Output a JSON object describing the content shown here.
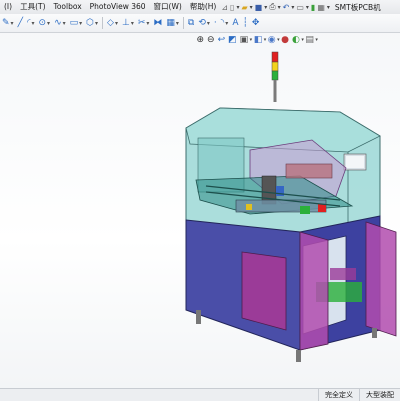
{
  "menubar": {
    "items": [
      {
        "label": "(I)",
        "name": "menu-insert"
      },
      {
        "label": "工具(T)",
        "name": "menu-tools"
      },
      {
        "label": "Toolbox",
        "name": "menu-toolbox"
      },
      {
        "label": "PhotoView 360",
        "name": "menu-photoview"
      },
      {
        "label": "窗口(W)",
        "name": "menu-window"
      },
      {
        "label": "帮助(H)",
        "name": "menu-help"
      }
    ],
    "document_title": "SMT板PCB机"
  },
  "statusbar": {
    "definition_status": "完全定义",
    "units": "大型装配"
  },
  "colors": {
    "enclosure_glass": "#8fd3d0",
    "cabinet": "#4a4ea8",
    "door_panel": "#9b3b98",
    "signal_red": "#e02020",
    "signal_yellow": "#f2d21c",
    "signal_green": "#2bb03a"
  }
}
